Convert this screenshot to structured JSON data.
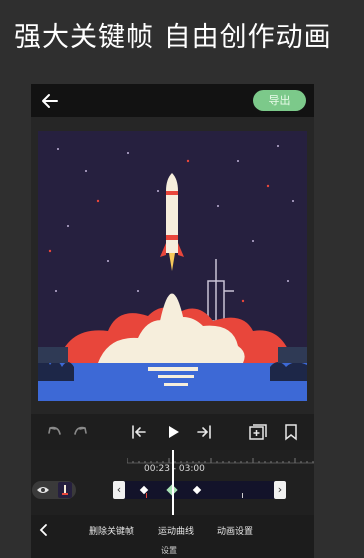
{
  "headline": "强大关键帧 自由创作动画",
  "topbar": {
    "export_label": "导出"
  },
  "timeline": {
    "timecode": "00:23 - 03:00"
  },
  "bottom_menu": {
    "items": [
      "删除关键帧",
      "运动曲线",
      "动画设置"
    ],
    "sub_label": "设置"
  },
  "colors": {
    "accent": "#7cc98a",
    "sky": "#26203f",
    "flame": "#e8463b",
    "water": "#3d69d6"
  },
  "icons": [
    "back-arrow-icon",
    "undo-icon",
    "redo-icon",
    "skip-start-icon",
    "play-icon",
    "skip-end-icon",
    "add-frame-icon",
    "bookmark-icon",
    "eye-icon",
    "close-icon"
  ]
}
